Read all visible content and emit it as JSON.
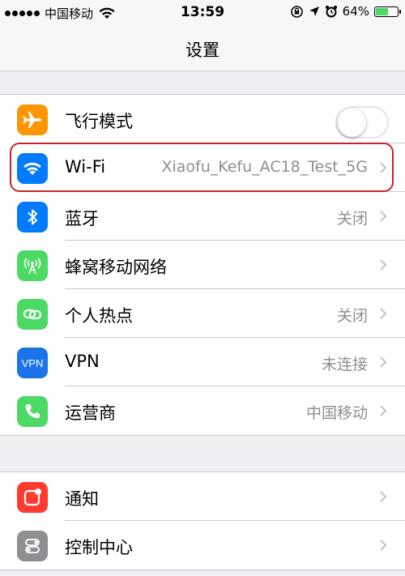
{
  "status_bar": {
    "carrier": "中国移动",
    "time": "13:59",
    "battery_text": "64%",
    "battery_level": 0.64,
    "battery_color": "#4cd964"
  },
  "nav": {
    "title": "设置"
  },
  "group1": [
    {
      "label": "飞行模式",
      "value": "",
      "icon": "airplane-icon",
      "color": "#ff9500",
      "toggle": true,
      "toggle_on": false
    },
    {
      "label": "Wi-Fi",
      "value": "Xiaofu_Kefu_AC18_Test_5G",
      "icon": "wifi-icon",
      "color": "#007aff"
    },
    {
      "label": "蓝牙",
      "value": "关闭",
      "icon": "bluetooth-icon",
      "color": "#007aff"
    },
    {
      "label": "蜂窝移动网络",
      "value": "",
      "icon": "cellular-icon",
      "color": "#4cd964"
    },
    {
      "label": "个人热点",
      "value": "关闭",
      "icon": "hotspot-icon",
      "color": "#4cd964"
    },
    {
      "label": "VPN",
      "value": "未连接",
      "icon": "vpn-icon",
      "icon_text": "VPN",
      "color": "#1a73e8"
    },
    {
      "label": "运营商",
      "value": "中国移动",
      "icon": "phone-icon",
      "color": "#4cd964"
    }
  ],
  "group2": [
    {
      "label": "通知",
      "value": "",
      "icon": "notifications-icon",
      "color": "#ff3b30"
    },
    {
      "label": "控制中心",
      "value": "",
      "icon": "control-center-icon",
      "color": "#8e8e93"
    }
  ],
  "accent_highlight_color": "#c4232d"
}
